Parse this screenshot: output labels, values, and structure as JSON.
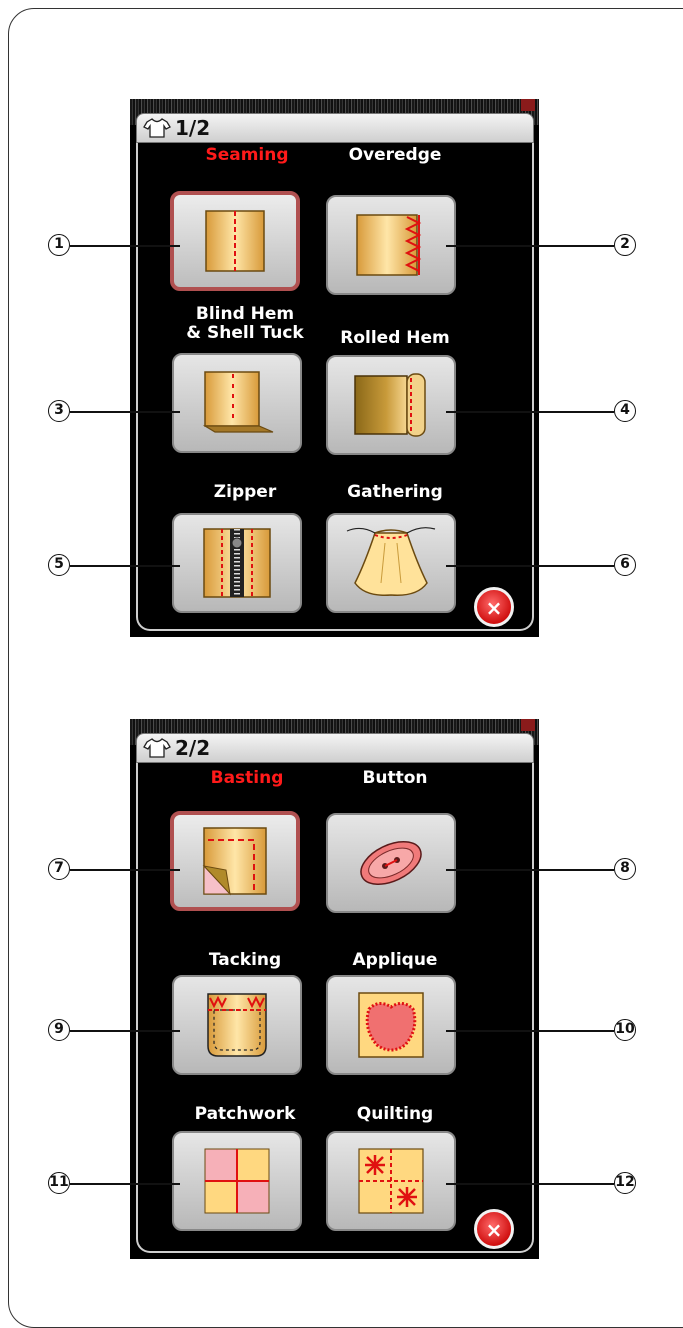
{
  "screens": [
    {
      "page_indicator": "1/2",
      "tiles": [
        {
          "label": "Seaming",
          "selected": true,
          "callout": "1"
        },
        {
          "label": "Overedge",
          "selected": false,
          "callout": "2"
        },
        {
          "label": "Blind Hem\n& Shell Tuck",
          "selected": false,
          "callout": "3"
        },
        {
          "label": "Rolled Hem",
          "selected": false,
          "callout": "4"
        },
        {
          "label": "Zipper",
          "selected": false,
          "callout": "5"
        },
        {
          "label": "Gathering",
          "selected": false,
          "callout": "6"
        }
      ],
      "close_label": "×"
    },
    {
      "page_indicator": "2/2",
      "tiles": [
        {
          "label": "Basting",
          "selected": true,
          "callout": "7"
        },
        {
          "label": "Button",
          "selected": false,
          "callout": "8"
        },
        {
          "label": "Tacking",
          "selected": false,
          "callout": "9"
        },
        {
          "label": "Applique",
          "selected": false,
          "callout": "10"
        },
        {
          "label": "Patchwork",
          "selected": false,
          "callout": "11"
        },
        {
          "label": "Quilting",
          "selected": false,
          "callout": "12"
        }
      ],
      "close_label": "×"
    }
  ],
  "colors": {
    "selected_label": "#ff1a1a",
    "selected_border": "#b05050",
    "close_button": "#d01010"
  },
  "icons": [
    "shirt-icon",
    "seaming-icon",
    "overedge-icon",
    "blind-hem-icon",
    "rolled-hem-icon",
    "zipper-icon",
    "gathering-icon",
    "basting-icon",
    "button-icon",
    "tacking-icon",
    "applique-icon",
    "patchwork-icon",
    "quilting-icon",
    "close-icon"
  ]
}
